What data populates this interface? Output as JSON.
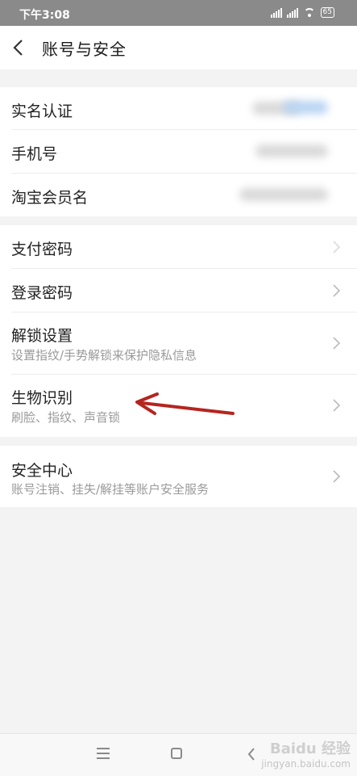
{
  "status_bar": {
    "time": "下午3:08",
    "battery": "65"
  },
  "header": {
    "title": "账号与安全"
  },
  "groups": [
    {
      "items": [
        {
          "label": "实名认证"
        },
        {
          "label": "手机号"
        },
        {
          "label": "淘宝会员名"
        }
      ]
    },
    {
      "items": [
        {
          "label": "支付密码"
        },
        {
          "label": "登录密码"
        },
        {
          "label": "解锁设置",
          "sub": "设置指纹/手势解锁来保护隐私信息"
        },
        {
          "label": "生物识别",
          "sub": "刷脸、指纹、声音锁"
        }
      ]
    },
    {
      "items": [
        {
          "label": "安全中心",
          "sub": "账号注销、挂失/解挂等账户安全服务"
        }
      ]
    }
  ],
  "annotation": {
    "arrow_color": "#b5251f"
  },
  "watermark": {
    "brand": "Baidu 经验",
    "url": "jingyan.baidu.com"
  }
}
